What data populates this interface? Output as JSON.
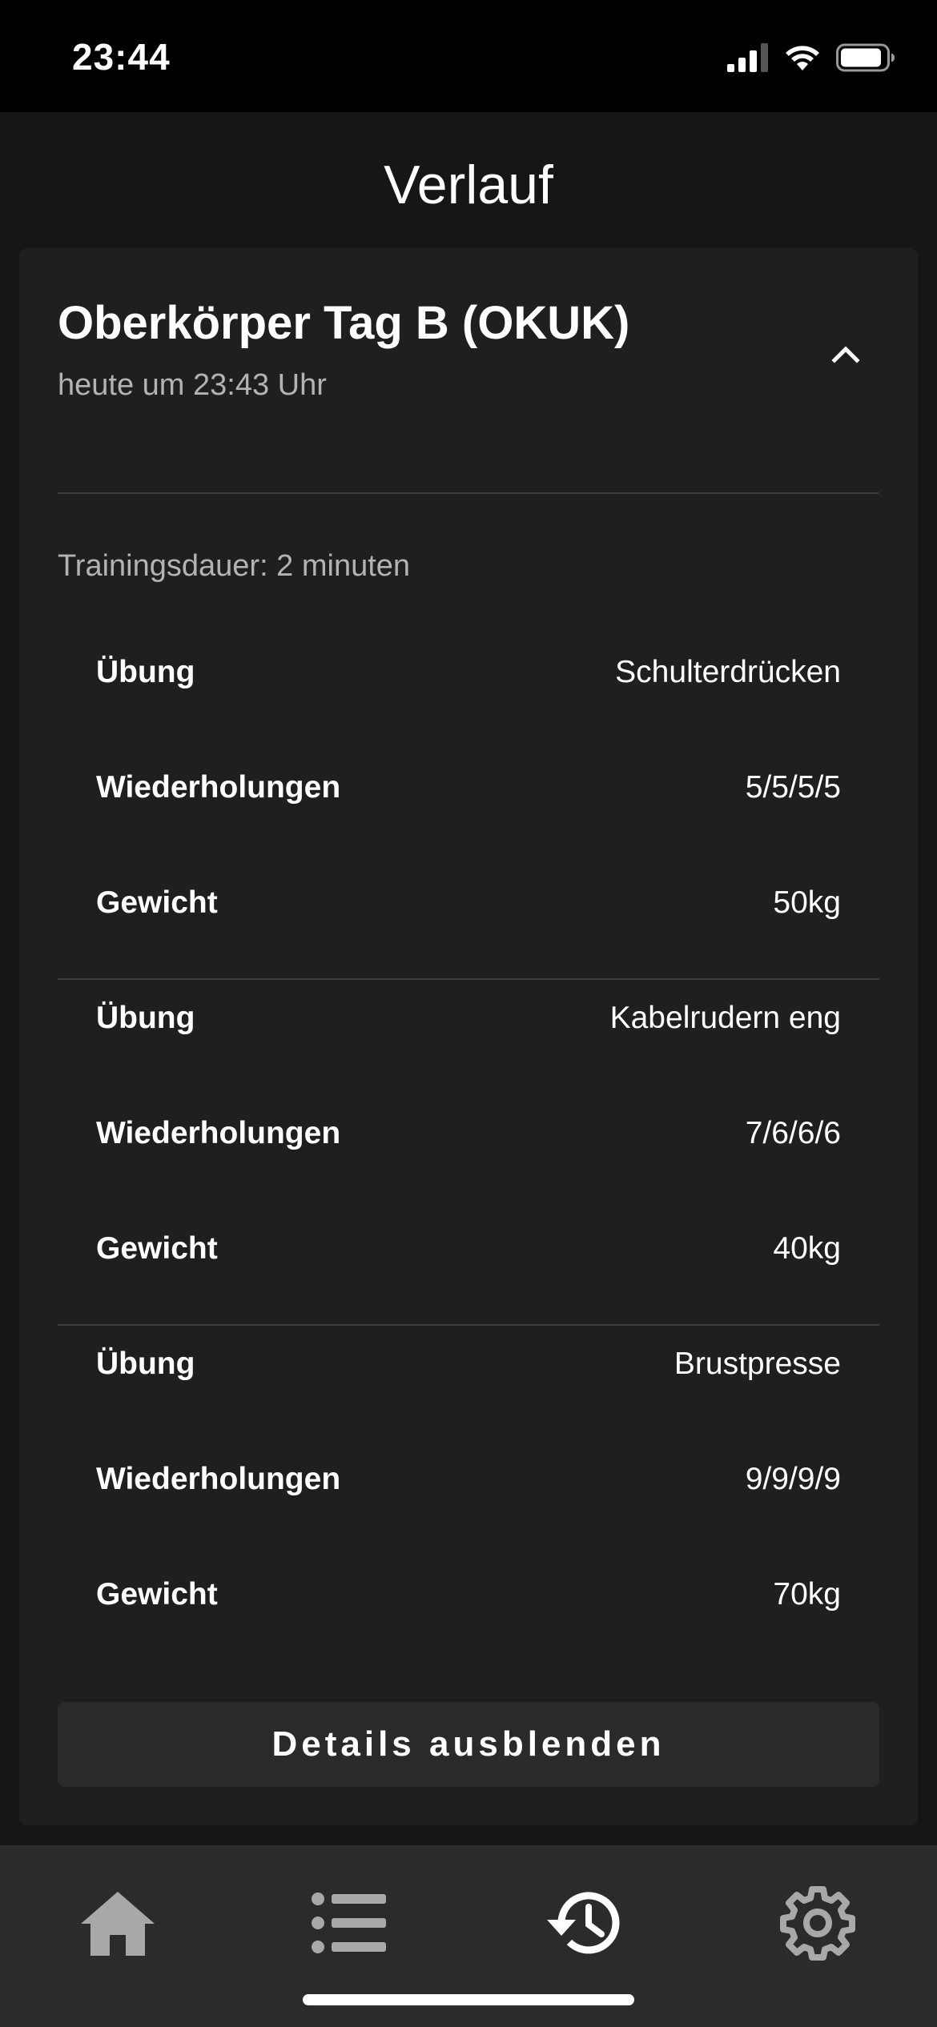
{
  "status": {
    "time": "23:44"
  },
  "page": {
    "title": "Verlauf"
  },
  "workout": {
    "title": "Oberkörper Tag B (OKUK)",
    "subtitle": "heute um 23:43 Uhr",
    "duration": "Trainingsdauer: 2 minuten",
    "exercises": [
      {
        "rows": [
          {
            "label": "Übung",
            "value": "Schulterdrücken"
          },
          {
            "label": "Wiederholungen",
            "value": "5/5/5/5"
          },
          {
            "label": "Gewicht",
            "value": "50kg"
          }
        ]
      },
      {
        "rows": [
          {
            "label": "Übung",
            "value": "Kabelrudern eng"
          },
          {
            "label": "Wiederholungen",
            "value": "7/6/6/6"
          },
          {
            "label": "Gewicht",
            "value": "40kg"
          }
        ]
      },
      {
        "rows": [
          {
            "label": "Übung",
            "value": "Brustpresse"
          },
          {
            "label": "Wiederholungen",
            "value": "9/9/9/9"
          },
          {
            "label": "Gewicht",
            "value": "70kg"
          }
        ]
      }
    ],
    "details_button": "Details ausblenden"
  },
  "tabs": [
    {
      "icon": "home-icon",
      "active": false
    },
    {
      "icon": "list-icon",
      "active": false
    },
    {
      "icon": "history-icon",
      "active": true
    },
    {
      "icon": "gear-icon",
      "active": false
    }
  ],
  "colors": {
    "active_icon": "#ffffff",
    "inactive_icon": "#a8a8a8",
    "card": "#1f1f1f",
    "background": "#161616"
  }
}
